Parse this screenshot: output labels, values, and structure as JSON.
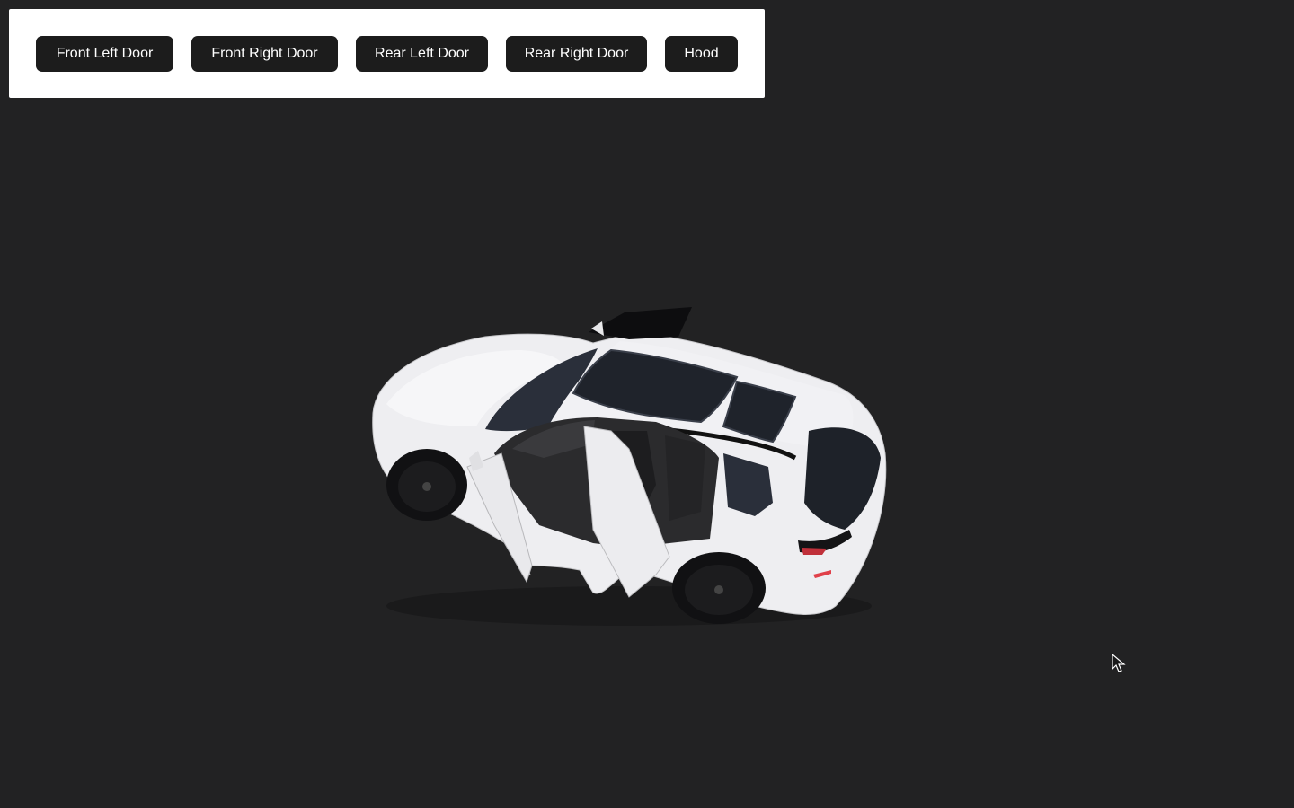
{
  "toolbar": {
    "buttons": [
      {
        "label": "Front Left Door"
      },
      {
        "label": "Front Right Door"
      },
      {
        "label": "Rear Left Door"
      },
      {
        "label": "Rear Right Door"
      },
      {
        "label": "Hood"
      }
    ]
  },
  "scene": {
    "object": "car-model-icon",
    "body_color": "#eeeef1",
    "background_color": "#222223"
  },
  "icons": {
    "cursor": "mouse-pointer-icon"
  }
}
